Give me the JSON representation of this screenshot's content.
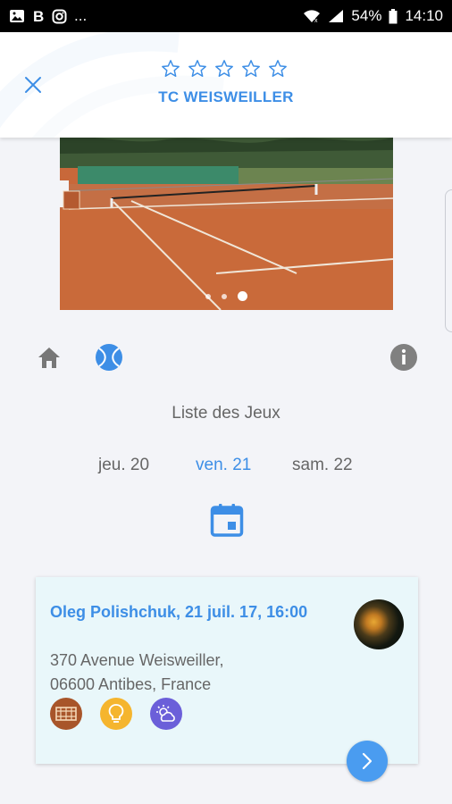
{
  "status_bar": {
    "left_icons": [
      "image-icon",
      "b-icon",
      "instagram-icon"
    ],
    "overflow": "...",
    "battery_percent": "54%",
    "time": "14:10"
  },
  "header": {
    "close_icon": "close-icon",
    "rating_stars": 0,
    "rating_max": 5,
    "title": "TC WEISWEILLER"
  },
  "gallery": {
    "pages": 3,
    "current_page": 3
  },
  "nav": {
    "home_icon": "home-icon",
    "ball_icon": "tennis-ball-icon",
    "info_icon": "info-icon"
  },
  "list_title": "Liste des Jeux",
  "days": [
    {
      "label": "jeu. 20",
      "selected": false
    },
    {
      "label": "ven. 21",
      "selected": true
    },
    {
      "label": "sam. 22",
      "selected": false
    }
  ],
  "calendar_icon": "calendar-icon",
  "game_card": {
    "title": "Oleg Polishchuk, 21 juil. 17, 16:00",
    "address_line1": "370 Avenue Weisweiller,",
    "address_line2": "06600 Antibes, France",
    "features": [
      {
        "icon": "court-surface-icon",
        "color": "#a8552a"
      },
      {
        "icon": "lightbulb-icon",
        "color": "#f5b52e"
      },
      {
        "icon": "weather-icon",
        "color": "#6b5fd9"
      }
    ],
    "next_icon": "chevron-right-icon"
  },
  "colors": {
    "accent": "#3d8ee6",
    "background": "#f3f4f8",
    "card_background": "#e9f7fa",
    "text_muted": "#666666"
  }
}
